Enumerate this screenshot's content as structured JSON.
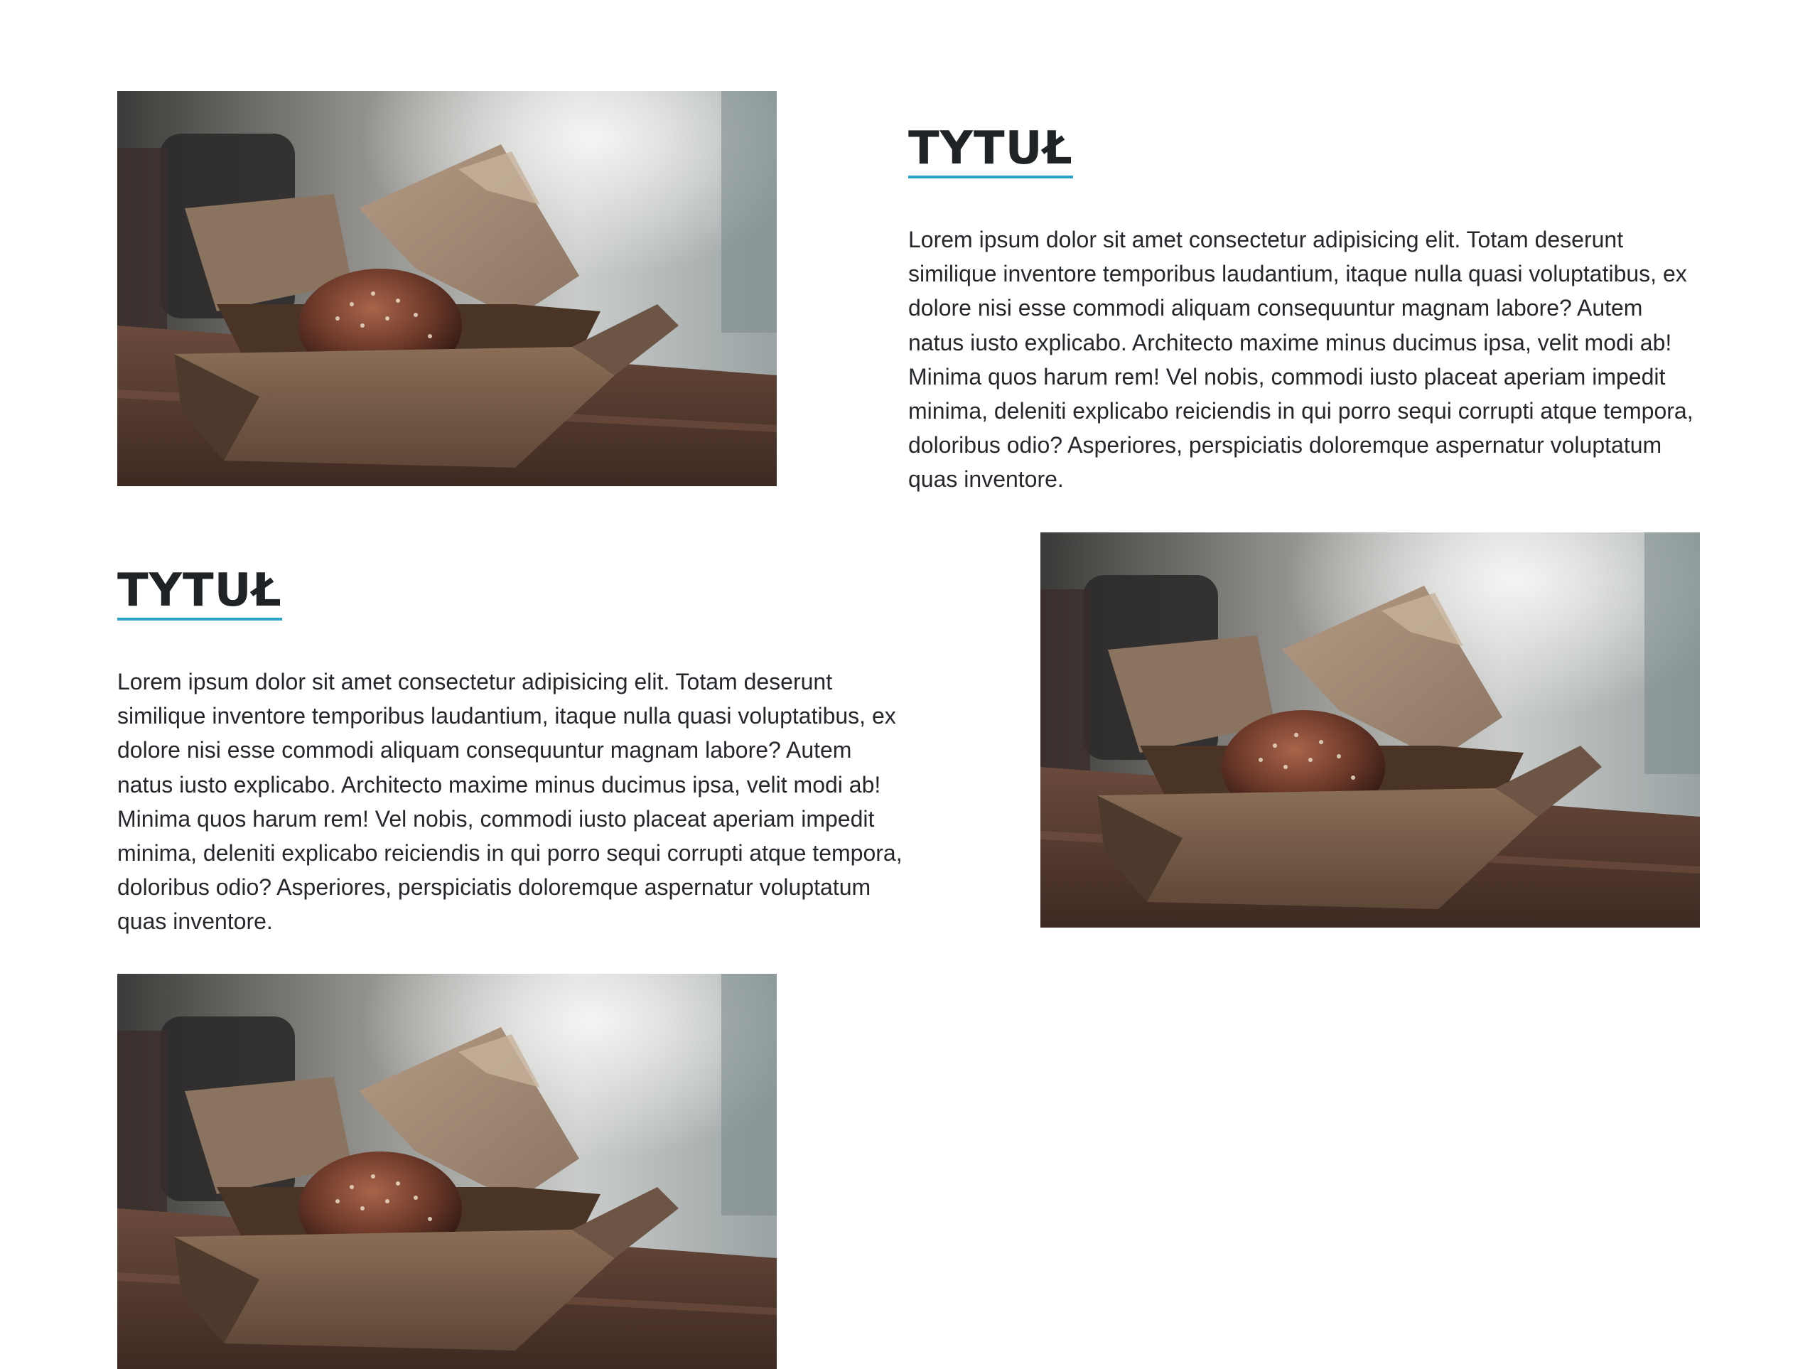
{
  "sections": [
    {
      "title": "TYTUŁ",
      "body": "Lorem ipsum dolor sit amet consectetur adipisicing elit. Totam deserunt similique inventore temporibus laudantium, itaque nulla quasi voluptatibus, ex dolore nisi esse commodi aliquam consequuntur magnam labore? Autem natus iusto explicabo. Architecto maxime minus ducimus ipsa, velit modi ab! Minima quos harum rem! Vel nobis, commodi iusto placeat aperiam impedit minima, deleniti explicabo reiciendis in qui porro sequi corrupti atque tempora, doloribus odio? Asperiores, perspiciatis doloremque aspernatur voluptatum quas inventore.",
      "image": "burger-takeout-box-photo",
      "image_side": "left"
    },
    {
      "title": "TYTUŁ",
      "body": "Lorem ipsum dolor sit amet consectetur adipisicing elit. Totam deserunt similique inventore temporibus laudantium, itaque nulla quasi voluptatibus, ex dolore nisi esse commodi aliquam consequuntur magnam labore? Autem natus iusto explicabo. Architecto maxime minus ducimus ipsa, velit modi ab! Minima quos harum rem! Vel nobis, commodi iusto placeat aperiam impedit minima, deleniti explicabo reiciendis in qui porro sequi corrupti atque tempora, doloribus odio? Asperiores, perspiciatis doloremque aspernatur voluptatum quas inventore.",
      "image": "burger-takeout-box-photo",
      "image_side": "right"
    },
    {
      "image": "burger-takeout-box-photo",
      "image_side": "left"
    }
  ],
  "colors": {
    "accent_underline": "#2aa3c7",
    "heading": "#1f2326",
    "text": "#24282c",
    "background": "#ffffff"
  }
}
